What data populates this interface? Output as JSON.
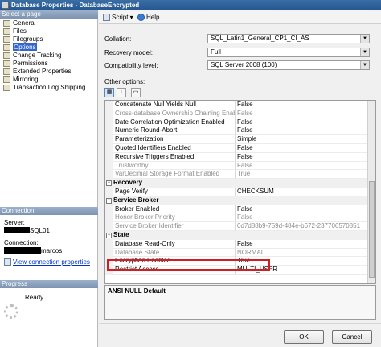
{
  "window": {
    "title": "Database Properties - DatabaseEncrypted"
  },
  "left_pane": {
    "select_page_header": "Select a page",
    "pages": [
      "General",
      "Files",
      "Filegroups",
      "Options",
      "Change Tracking",
      "Permissions",
      "Extended Properties",
      "Mirroring",
      "Transaction Log Shipping"
    ],
    "selected_page": "Options",
    "connection_header": "Connection",
    "server_label": "Server:",
    "server_value": "SQL01",
    "connection_label": "Connection:",
    "connection_value": "marcos",
    "view_connection_link": "View connection properties",
    "progress_header": "Progress",
    "progress_status": "Ready"
  },
  "toolbar": {
    "script_label": "Script",
    "help_label": "Help"
  },
  "form": {
    "collation_label": "Collation:",
    "collation_value": "SQL_Latin1_General_CP1_CI_AS",
    "recovery_label": "Recovery model:",
    "recovery_value": "Full",
    "compat_label": "Compatibility level:",
    "compat_value": "SQL Server 2008 (100)",
    "other_options_label": "Other options:"
  },
  "property_grid": {
    "rows": [
      {
        "type": "row",
        "name": "Concatenate Null Yields Null",
        "value": "False",
        "disabled": false
      },
      {
        "type": "row",
        "name": "Cross-database Ownership Chaining Enabled",
        "value": "False",
        "disabled": true
      },
      {
        "type": "row",
        "name": "Date Correlation Optimization Enabled",
        "value": "False",
        "disabled": false
      },
      {
        "type": "row",
        "name": "Numeric Round-Abort",
        "value": "False",
        "disabled": false
      },
      {
        "type": "row",
        "name": "Parameterization",
        "value": "Simple",
        "disabled": false
      },
      {
        "type": "row",
        "name": "Quoted Identifiers Enabled",
        "value": "False",
        "disabled": false
      },
      {
        "type": "row",
        "name": "Recursive Triggers Enabled",
        "value": "False",
        "disabled": false
      },
      {
        "type": "row",
        "name": "Trustworthy",
        "value": "False",
        "disabled": true
      },
      {
        "type": "row",
        "name": "VarDecimal Storage Format Enabled",
        "value": "True",
        "disabled": true
      },
      {
        "type": "category",
        "name": "Recovery"
      },
      {
        "type": "row",
        "name": "Page Verify",
        "value": "CHECKSUM",
        "disabled": false
      },
      {
        "type": "category",
        "name": "Service Broker"
      },
      {
        "type": "row",
        "name": "Broker Enabled",
        "value": "False",
        "disabled": false
      },
      {
        "type": "row",
        "name": "Honor Broker Priority",
        "value": "False",
        "disabled": true
      },
      {
        "type": "row",
        "name": "Service Broker Identifier",
        "value": "0d7d88b9-759d-484e-b672-237706570851",
        "disabled": true
      },
      {
        "type": "category",
        "name": "State"
      },
      {
        "type": "row",
        "name": "Database Read-Only",
        "value": "False",
        "disabled": false
      },
      {
        "type": "row",
        "name": "Database State",
        "value": "NORMAL",
        "disabled": true
      },
      {
        "type": "row",
        "name": "Encryption Enabled",
        "value": "True",
        "disabled": false
      },
      {
        "type": "row",
        "name": "Restrict Access",
        "value": "MULTI_USER",
        "disabled": false
      }
    ]
  },
  "description": {
    "title": "ANSI NULL Default"
  },
  "buttons": {
    "ok": "OK",
    "cancel": "Cancel"
  },
  "colors": {
    "highlight_box": "#d11e25",
    "selected_page_bg": "#3366cc",
    "title_bar": "#2a5a94"
  },
  "icons": [
    "database-icon",
    "page-icon",
    "script-icon",
    "help-icon",
    "categorized-icon",
    "alphabetical-icon",
    "property-pages-icon",
    "spinner-icon"
  ]
}
